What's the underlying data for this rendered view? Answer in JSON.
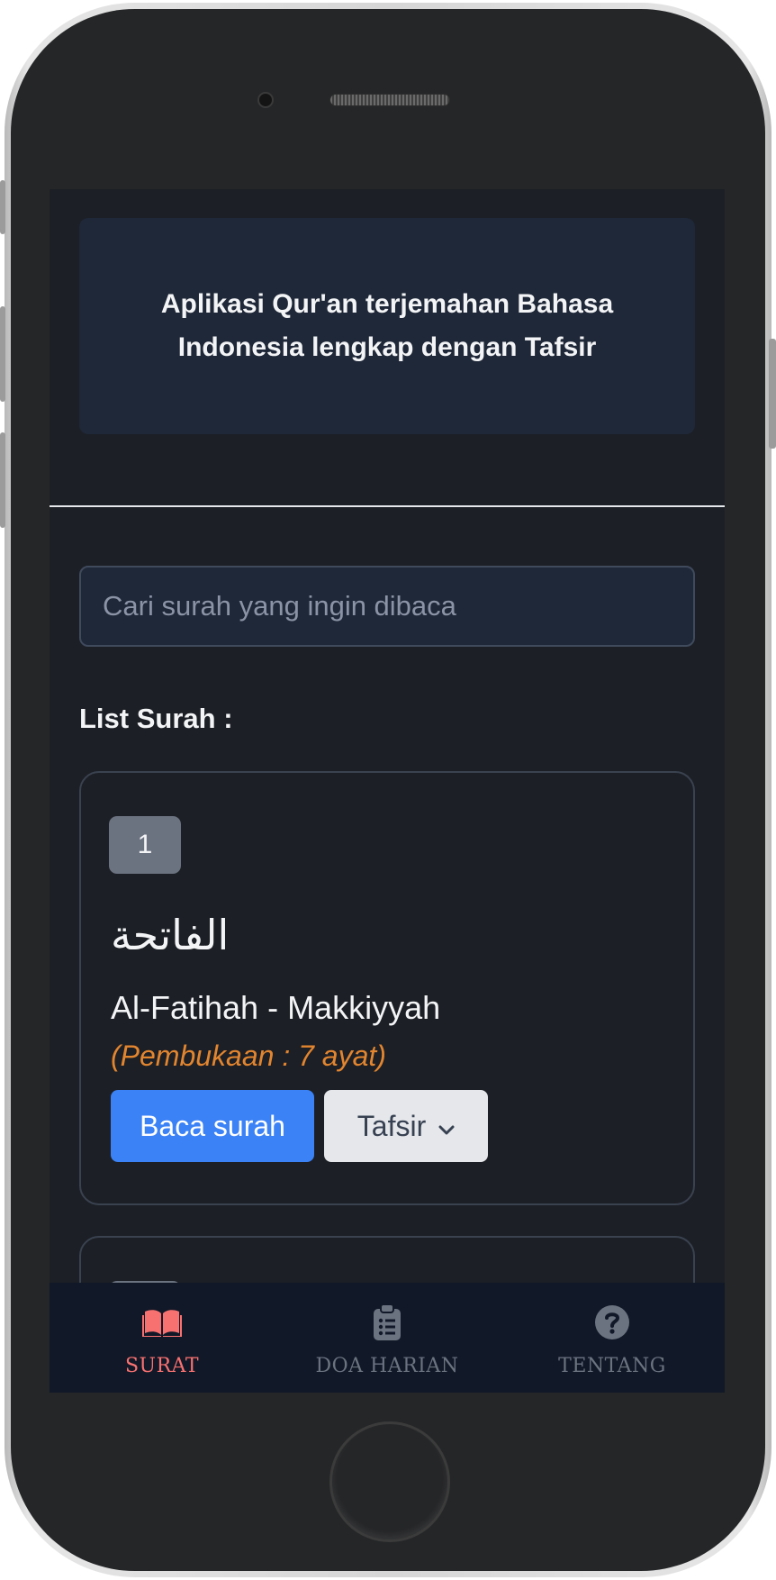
{
  "header": {
    "description": "Aplikasi Qur'an terjemahan Bahasa Indonesia lengkap dengan Tafsir"
  },
  "search": {
    "placeholder": "Cari surah yang ingin dibaca",
    "value": ""
  },
  "list": {
    "heading": "List Surah :",
    "surahs": [
      {
        "number": "1",
        "arabic": "الفاتحة",
        "name_place": "Al-Fatihah - Makkiyyah",
        "meaning_ayat": "(Pembukaan : 7 ayat)",
        "read_label": "Baca surah",
        "tafsir_label": "Tafsir"
      }
    ]
  },
  "bottom_nav": {
    "items": [
      {
        "label": "SURAT",
        "icon": "book-open-icon",
        "active": true
      },
      {
        "label": "DOA HARIAN",
        "icon": "clipboard-list-icon",
        "active": false
      },
      {
        "label": "TENTANG",
        "icon": "question-circle-icon",
        "active": false
      }
    ]
  },
  "colors": {
    "background": "#1c1f25",
    "card_border": "#3a4250",
    "primary_button": "#3b82f6",
    "accent_orange": "#e2852f",
    "active_nav": "#f87171",
    "inactive_nav": "#6b7280"
  }
}
